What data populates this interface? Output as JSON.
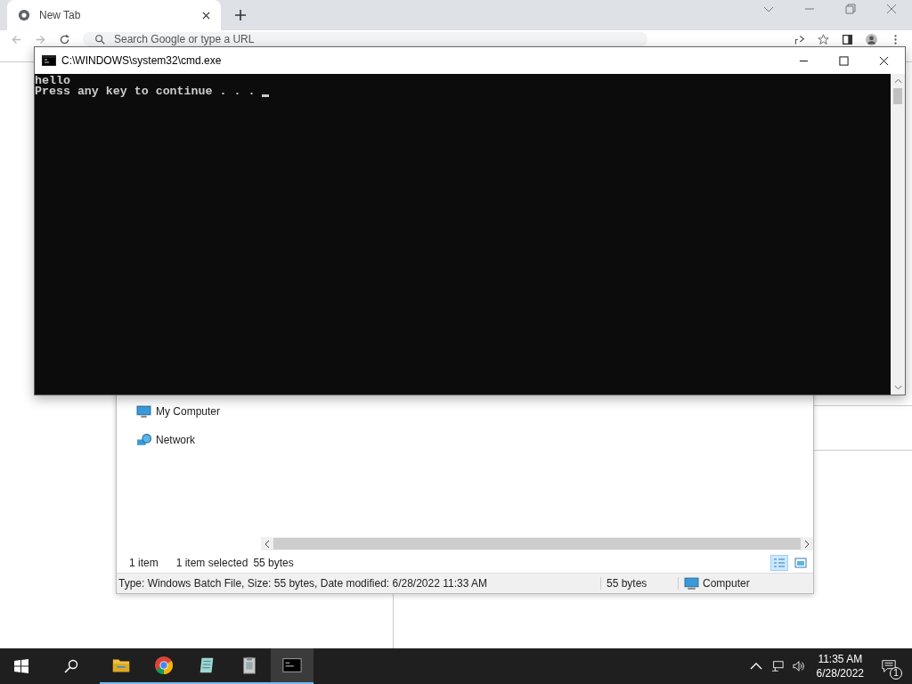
{
  "browser": {
    "tabs": [
      {
        "title": "New Tab",
        "selected": true
      }
    ],
    "address_placeholder": "Search Google or type a URL"
  },
  "console": {
    "title": "C:\\WINDOWS\\system32\\cmd.exe",
    "lines": [
      "hello",
      "Press any key to continue . . . "
    ],
    "cursor": true
  },
  "explorer": {
    "nav_items": [
      {
        "label": "My Computer",
        "kind": "computer"
      },
      {
        "label": "Network",
        "kind": "network"
      }
    ],
    "item_count": "1 item",
    "selection": "1 item selected",
    "selection_size": "55 bytes",
    "views": [
      {
        "kind": "details",
        "selected": true
      },
      {
        "kind": "preview",
        "selected": false
      }
    ],
    "status_bar": {
      "details": "Type: Windows Batch File, Size: 55 bytes, Date modified: 6/28/2022 11:33 AM",
      "size": "55 bytes",
      "zone": "Computer"
    }
  },
  "taskbar": {
    "apps": [
      {
        "kind": "folder",
        "running": true,
        "selected": false
      },
      {
        "kind": "browser",
        "running": true,
        "selected": false
      },
      {
        "kind": "notepad",
        "running": true,
        "selected": false
      },
      {
        "kind": "archive",
        "running": true,
        "selected": false
      },
      {
        "kind": "console",
        "running": true,
        "selected": true
      }
    ],
    "clock": {
      "time": "11:35 AM",
      "date": "6/28/2022"
    },
    "notification_count": "1"
  }
}
